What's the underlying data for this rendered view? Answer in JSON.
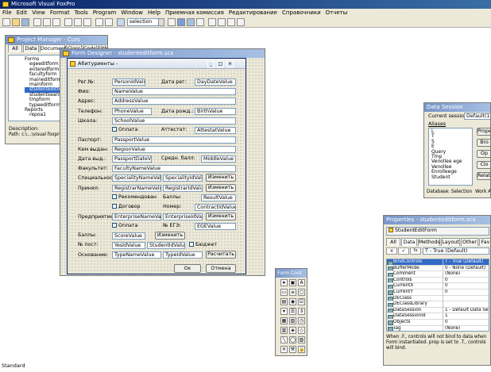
{
  "app": {
    "title": "Microsoft Visual FoxPro",
    "status": "Standard"
  },
  "menu": [
    "File",
    "Edit",
    "View",
    "Format",
    "Tools",
    "Program",
    "Window",
    "Help",
    "Приемная комиссия",
    "Редактирование",
    "Справочники",
    "Отчеты"
  ],
  "toolbar": {
    "combo_value": "selection"
  },
  "project": {
    "title": "Project Manager - Curs",
    "tabs": [
      "All",
      "Data",
      "Documents",
      "Class",
      "Code",
      "Other"
    ],
    "tree": [
      "Forms",
      "egeeditform",
      "enteredform",
      "facultyform",
      "maineditform",
      "mainform",
      "studenteditform",
      "studentsearchform",
      "tmpform",
      "typeeditform",
      "Reports",
      "repoa1"
    ],
    "desc_label": "Description:",
    "path": "Path: c:\\...\\visual foxpro project\\"
  },
  "form_designer": {
    "title": "Form Designer - studenteditform.scx",
    "form_title": "Абитуриенты -",
    "labels": {
      "reg_no": "Рег.№:",
      "reg_date": "Дата рег:",
      "fio": "Фио:",
      "address": "Адрес:",
      "phone": "Телефон:",
      "birth": "Дата рожд.:",
      "school": "Школа:",
      "attest": "Аттестат:",
      "passport": "Паспорт:",
      "issued": "Кем выдан:",
      "issue_date": "Дата выд.:",
      "avg": "Средн. балл:",
      "faculty": "Факультет:",
      "specialty": "Специальность:",
      "registrar": "Принял:",
      "scores": "Баллы:",
      "number": "Номер:",
      "enterprise": "Предприятие:",
      "ege_no": "№ ЕГЭ:",
      "scores2": "Баллы:",
      "post_no": "№ пост:",
      "basis": "Основание:"
    },
    "fields": {
      "person_id": "PersonIdValue",
      "day_date": "DayDateValue",
      "name": "NameValue",
      "address": "AddressValue",
      "phone": "PhoneValue",
      "birth": "BirthValue",
      "school": "SchoolValue",
      "attestat": "AttestatValue",
      "passport": "PassportValue",
      "region": "RegionValue",
      "passport_date": "PassportDateValu",
      "middle": "MiddleValue",
      "faculty": "FacultyNameValue",
      "spec_name": "SpecialityNameValue",
      "spec_id": "SpecialityIdValue",
      "reg_name": "RegistrarNameValue",
      "reg_id": "RegistrarIdValue",
      "result": "ResultValue",
      "contract": "ContractIdValue",
      "ent_name": "EnterpriseNameValue",
      "ent_id": "EnterpriseIdValue",
      "ege": "EGEValue",
      "score": "ScoreValue",
      "yes_id": "YesIdValue",
      "student_id": "StudentIdValue",
      "type_name": "TypeNameValue",
      "type_id": "TypeIdValue"
    },
    "checks": {
      "pay": "Оплата",
      "recommend": "Рекомендован",
      "contract": "Договор",
      "pay2": "Оплата",
      "budget": "Бюджет"
    },
    "buttons": {
      "change": "Изменить",
      "calc": "Расчитать",
      "ok": "Ок",
      "cancel": "Отмена"
    }
  },
  "data_session": {
    "title": "Data Session",
    "current_label": "Current session:",
    "current_value": "Default(1)",
    "aliases_label": "Aliases",
    "aliases": [
      "L",
      "T",
      "S",
      "E",
      "Query",
      "Tmp",
      "Venollee ege",
      "Venollee",
      "Enrolleege",
      "Student"
    ],
    "buttons": [
      "Prope",
      "Bro",
      "Op",
      "Clo",
      "Relati"
    ],
    "status": "Database: Selection",
    "status2": "Work Ar"
  },
  "properties": {
    "title": "Properties - studenteditform.scx",
    "object": "StudentEditForm",
    "tabs": [
      "All",
      "Data",
      "Methods",
      "Layout",
      "Other",
      "Fav"
    ],
    "edit_value": "T - True (Default)",
    "rows": [
      [
        "BindControls",
        "T - True (Default)"
      ],
      [
        "BufferMode",
        "0 - None (Default)"
      ],
      [
        "Comment",
        "(None)"
      ],
      [
        "Controls",
        "0"
      ],
      [
        "CurrentX",
        "0"
      ],
      [
        "CurrentY",
        "0"
      ],
      [
        "DEClass",
        ""
      ],
      [
        "DEClassLibrary",
        ""
      ],
      [
        "DataSession",
        "1 - Default Data Session"
      ],
      [
        "DataSessionId",
        "1"
      ],
      [
        "Objects",
        "0"
      ],
      [
        "Tag",
        "(None)"
      ]
    ],
    "desc": "When .F., controls will not bind to data when Form instantiated. prop is set to .T., controls will bind."
  },
  "form_controls": {
    "title": "Form Cont"
  }
}
